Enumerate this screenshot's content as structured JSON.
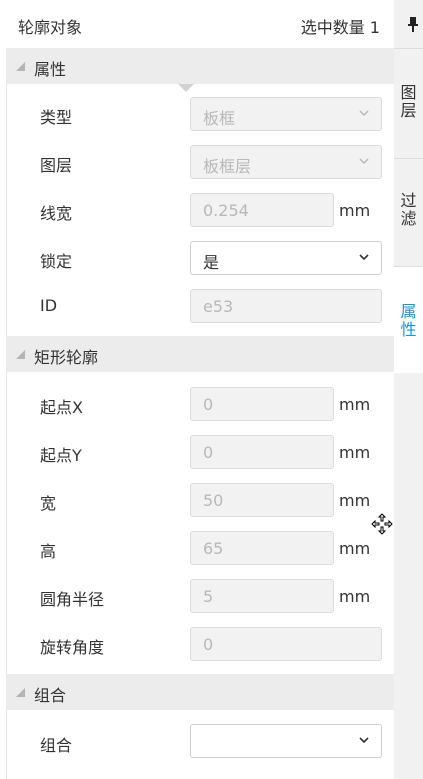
{
  "header": {
    "title": "轮廓对象",
    "selected_count": "选中数量 1"
  },
  "sections": {
    "properties": "属性",
    "rect_outline": "矩形轮廓",
    "group": "组合"
  },
  "properties": {
    "type": {
      "label": "类型",
      "value": "板框"
    },
    "layer": {
      "label": "图层",
      "value": "板框层"
    },
    "line_width": {
      "label": "线宽",
      "value": "0.254",
      "unit": "mm"
    },
    "locked": {
      "label": "锁定",
      "value": "是"
    },
    "id": {
      "label": "ID",
      "value": "e53"
    }
  },
  "rect_outline": {
    "start_x": {
      "label": "起点X",
      "value": "0",
      "unit": "mm"
    },
    "start_y": {
      "label": "起点Y",
      "value": "0",
      "unit": "mm"
    },
    "width": {
      "label": "宽",
      "value": "50",
      "unit": "mm"
    },
    "height": {
      "label": "高",
      "value": "65",
      "unit": "mm"
    },
    "corner_radius": {
      "label": "圆角半径",
      "value": "5",
      "unit": "mm"
    },
    "rotation": {
      "label": "旋转角度",
      "value": "0"
    }
  },
  "group": {
    "group": {
      "label": "组合",
      "value": ""
    }
  },
  "side_tabs": {
    "layers": [
      "图",
      "层"
    ],
    "filter": [
      "过",
      "滤"
    ],
    "properties": [
      "属",
      "性"
    ]
  },
  "colors": {
    "accent": "#1296db",
    "section_bg": "#ececec",
    "disabled_field_bg": "#f2f2f2"
  },
  "icons": {
    "pin": "pin-icon",
    "chevron": "chevron-down-icon",
    "cursor": "move-cursor-icon"
  }
}
